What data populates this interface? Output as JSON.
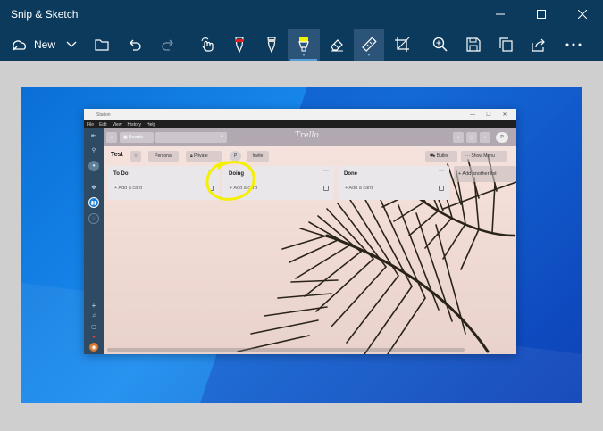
{
  "window": {
    "title": "Snip & Sketch"
  },
  "toolbar": {
    "new_label": "New"
  },
  "station": {
    "title": "Station",
    "menu": [
      "File",
      "Edit",
      "View",
      "History",
      "Help"
    ]
  },
  "trello": {
    "boards_label": "Boards",
    "logo": "Trello",
    "board_title": "Test",
    "personal_label": "Personal",
    "private_label": "Private",
    "avatar_initial": "P",
    "invite_label": "Invite",
    "butler_label": "Butler",
    "show_menu_label": "Show Menu",
    "profile_initial": "P",
    "add_another_list": "+ Add another list",
    "lists": [
      {
        "title": "To Do",
        "add": "+ Add a card"
      },
      {
        "title": "Doing",
        "add": "+ Add a card"
      },
      {
        "title": "Done",
        "add": "+ Add a card"
      }
    ]
  },
  "colors": {
    "titlebar": "#0c3a5d",
    "highlighter": "#f5f000",
    "desktop_blue": "#1b8df0"
  }
}
